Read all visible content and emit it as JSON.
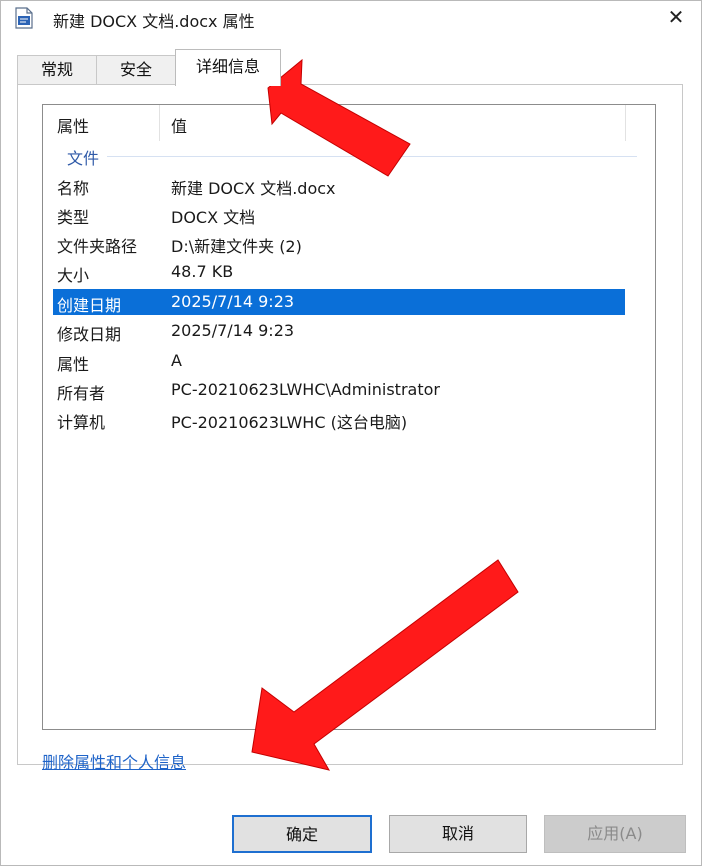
{
  "window": {
    "title": "新建 DOCX 文档.docx 属性",
    "close_symbol": "✕"
  },
  "tabs": [
    {
      "label": "常规"
    },
    {
      "label": "安全"
    },
    {
      "label": "详细信息"
    }
  ],
  "details": {
    "columns": {
      "property": "属性",
      "value": "值"
    },
    "group": "文件",
    "rows": [
      {
        "key": "名称",
        "value": "新建 DOCX 文档.docx"
      },
      {
        "key": "类型",
        "value": "DOCX 文档"
      },
      {
        "key": "文件夹路径",
        "value": "D:\\新建文件夹 (2)"
      },
      {
        "key": "大小",
        "value": "48.7 KB"
      },
      {
        "key": "创建日期",
        "value": "2025/7/14 9:23"
      },
      {
        "key": "修改日期",
        "value": "2025/7/14 9:23"
      },
      {
        "key": "属性",
        "value": "A"
      },
      {
        "key": "所有者",
        "value": "PC-20210623LWHC\\Administrator"
      },
      {
        "key": "计算机",
        "value": "PC-20210623LWHC (这台电脑)"
      }
    ],
    "selected_row": "创建日期"
  },
  "remove_link": "删除属性和个人信息",
  "buttons": {
    "ok": "确定",
    "cancel": "取消",
    "apply": "应用(A)"
  },
  "colors": {
    "selection": "#0a6fd8",
    "link": "#1e63c8",
    "annotation_arrow": "#ff1a1a"
  },
  "icons": [
    "document-icon",
    "close-icon"
  ]
}
